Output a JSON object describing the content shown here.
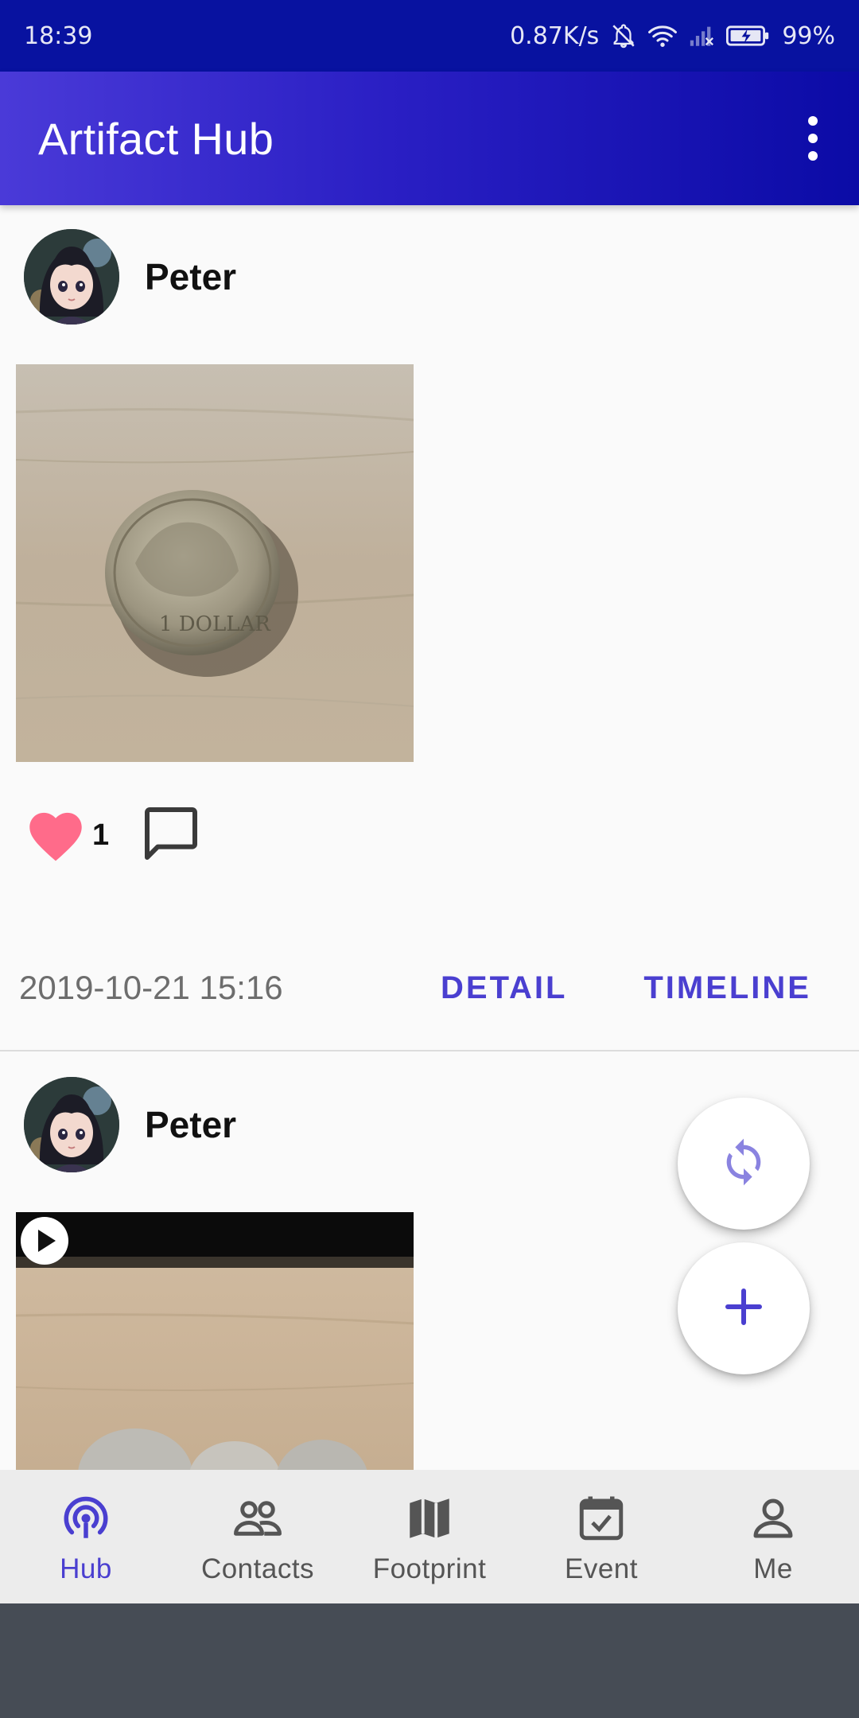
{
  "status_bar": {
    "time": "18:39",
    "network_speed": "0.87K/s",
    "battery": "99%"
  },
  "app_bar": {
    "title": "Artifact Hub",
    "menu_icon": "more-vert-icon"
  },
  "posts": [
    {
      "author": "Peter",
      "media_type": "photo",
      "media_subject": "Australian 1 dollar coin",
      "likes": "1",
      "timestamp": "2019-10-21 15:16",
      "detail_label": "DETAIL",
      "timeline_label": "TIMELINE"
    },
    {
      "author": "Peter",
      "media_type": "video"
    }
  ],
  "fabs": {
    "refresh_icon": "refresh-icon",
    "add_icon": "add-icon"
  },
  "bottom_nav": {
    "items": [
      {
        "label": "Hub",
        "icon": "hub-icon",
        "active": true
      },
      {
        "label": "Contacts",
        "icon": "contacts-icon"
      },
      {
        "label": "Footprint",
        "icon": "map-icon"
      },
      {
        "label": "Event",
        "icon": "event-icon"
      },
      {
        "label": "Me",
        "icon": "person-icon"
      }
    ]
  },
  "colors": {
    "primary": "#4a3fd0",
    "status_bar": "#0812a0",
    "like": "#ff6b8a"
  }
}
